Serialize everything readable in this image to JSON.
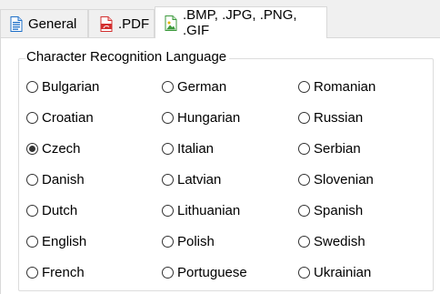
{
  "tabs": [
    {
      "label": "General",
      "icon": "document-icon",
      "selected": false
    },
    {
      "label": ".PDF",
      "icon": "pdf-icon",
      "selected": false
    },
    {
      "label": ".BMP, .JPG, .PNG, .GIF",
      "icon": "image-icon",
      "selected": true
    }
  ],
  "group": {
    "title": "Character Recognition Language",
    "options": [
      {
        "label": "Bulgarian",
        "checked": false
      },
      {
        "label": "Croatian",
        "checked": false
      },
      {
        "label": "Czech",
        "checked": true
      },
      {
        "label": "Danish",
        "checked": false
      },
      {
        "label": "Dutch",
        "checked": false
      },
      {
        "label": "English",
        "checked": false
      },
      {
        "label": "French",
        "checked": false
      },
      {
        "label": "German",
        "checked": false
      },
      {
        "label": "Hungarian",
        "checked": false
      },
      {
        "label": "Italian",
        "checked": false
      },
      {
        "label": "Latvian",
        "checked": false
      },
      {
        "label": "Lithuanian",
        "checked": false
      },
      {
        "label": "Polish",
        "checked": false
      },
      {
        "label": "Portuguese",
        "checked": false
      },
      {
        "label": "Romanian",
        "checked": false
      },
      {
        "label": "Russian",
        "checked": false
      },
      {
        "label": "Serbian",
        "checked": false
      },
      {
        "label": "Slovenian",
        "checked": false
      },
      {
        "label": "Spanish",
        "checked": false
      },
      {
        "label": "Swedish",
        "checked": false
      },
      {
        "label": "Ukrainian",
        "checked": false
      }
    ]
  },
  "colors": {
    "doc_icon": "#1e6fc8",
    "pdf_icon": "#d32f2f",
    "image_icon": "#3c9a3c"
  }
}
